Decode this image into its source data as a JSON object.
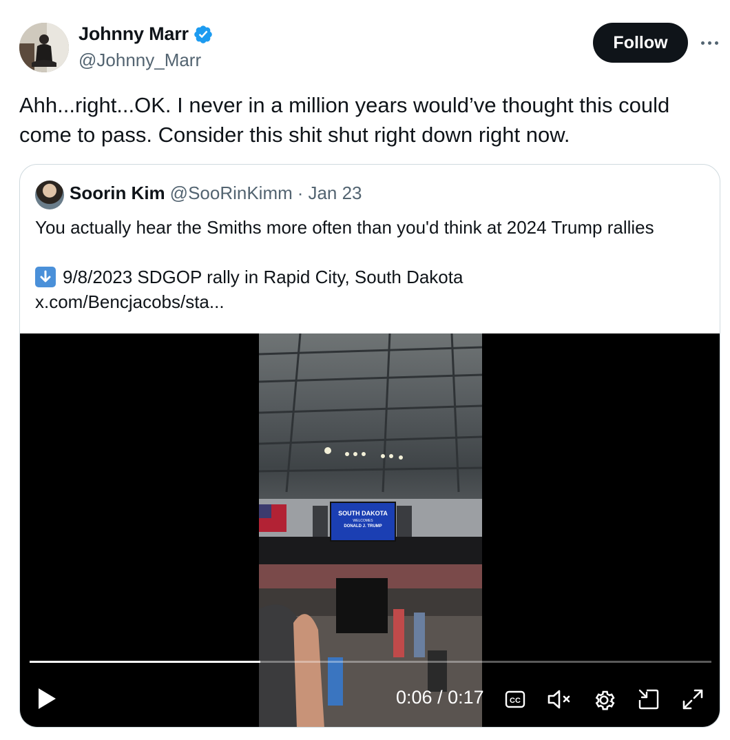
{
  "author": {
    "name": "Johnny Marr",
    "handle": "@Johnny_Marr",
    "verified": true,
    "verified_color": "#1d9bf0"
  },
  "follow_label": "Follow",
  "tweet_text": "Ahh...right...OK. I never in a million years would’ve thought this could come to pass. Consider this shit shut right down right now.",
  "quoted": {
    "name": "Soorin Kim",
    "handle": "@SooRinKimm",
    "separator": "·",
    "date": "Jan 23",
    "text": "You actually hear the Smiths more often than you'd think at 2024 Trump rallies",
    "emoji": "⬇️",
    "line2": "9/8/2023 SDGOP rally in Rapid City, South Dakota",
    "link": "x.com/Bencjacobs/sta..."
  },
  "video": {
    "screen_text": [
      "SOUTH DAKOTA",
      "WELCOMES",
      "DONALD J. TRUMP"
    ],
    "current_time": "0:06",
    "duration": "0:17",
    "time_separator": "/",
    "progress_fraction": 0.338,
    "controls": [
      "play-icon",
      "captions-icon",
      "muted-icon",
      "settings-icon",
      "pip-icon",
      "fullscreen-icon"
    ]
  },
  "colors": {
    "text_primary": "#0f1419",
    "text_secondary": "#536471",
    "border": "#cfd9de",
    "follow_bg": "#0f1419"
  }
}
